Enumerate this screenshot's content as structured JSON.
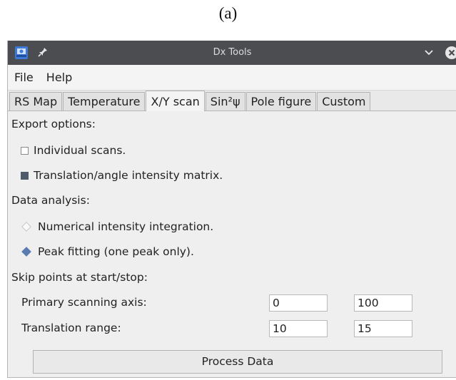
{
  "caption": "(a)",
  "window": {
    "title": "Dx Tools"
  },
  "menu": [
    "File",
    "Help"
  ],
  "tabs": [
    {
      "label": "RS Map",
      "active": false
    },
    {
      "label": "Temperature",
      "active": false
    },
    {
      "label": "X/Y scan",
      "active": true
    },
    {
      "label": "Sin²ψ",
      "active": false
    },
    {
      "label": "Pole figure",
      "active": false
    },
    {
      "label": "Custom",
      "active": false
    }
  ],
  "export": {
    "label": "Export options:",
    "individual_scans": {
      "label": "Individual scans.",
      "checked": false
    },
    "intensity_matrix": {
      "label": "Translation/angle intensity matrix.",
      "checked": true
    }
  },
  "analysis": {
    "label": "Data analysis:",
    "numerical": {
      "label": "Numerical intensity integration.",
      "selected": false
    },
    "peak_fitting": {
      "label": "Peak fitting (one peak only).",
      "selected": true
    }
  },
  "skip": {
    "label": "Skip points at start/stop:",
    "primary": {
      "label": "Primary scanning axis:",
      "start": "0",
      "stop": "100"
    },
    "translation": {
      "label": "Translation range:",
      "start": "10",
      "stop": "15"
    }
  },
  "process_button": "Process Data",
  "colors": {
    "titlebar": "#4b4d50",
    "accent": "#5b7cb0",
    "close": "#e6e6e6"
  }
}
